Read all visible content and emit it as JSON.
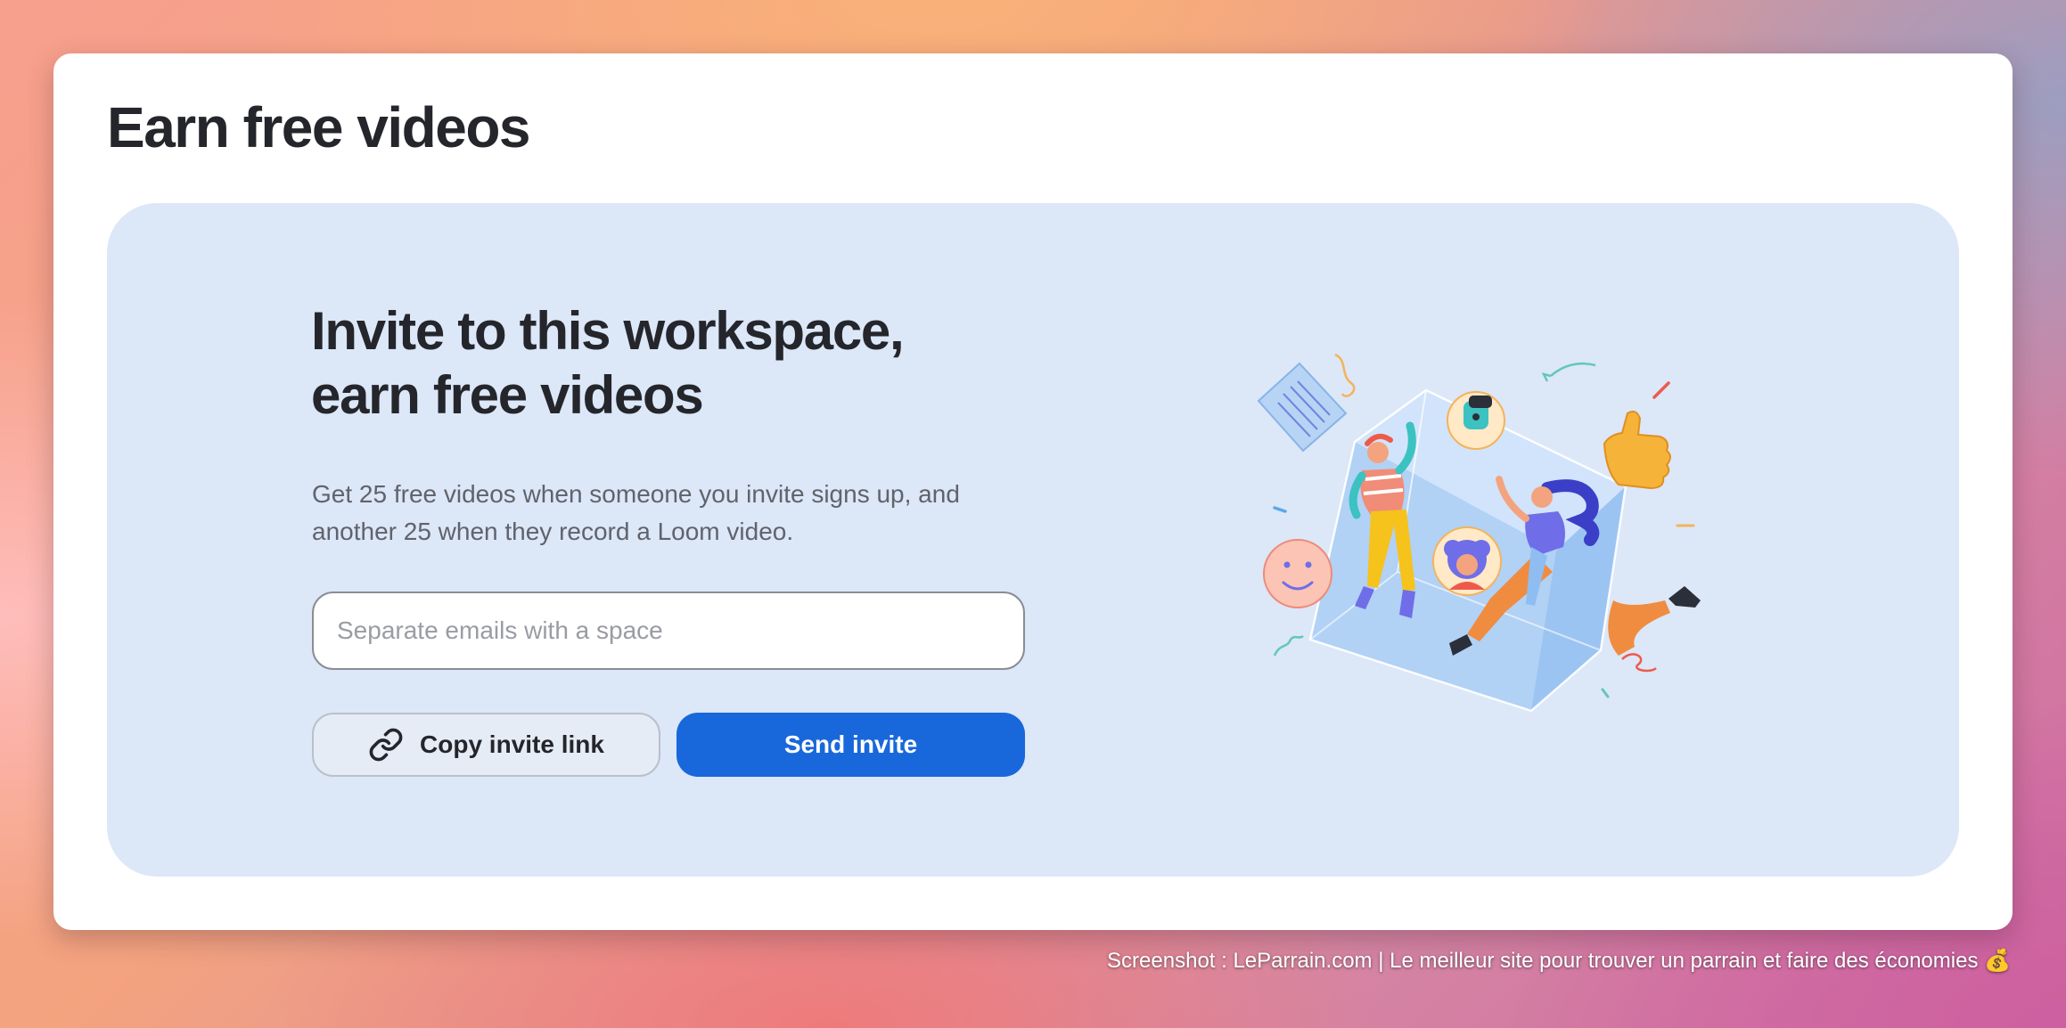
{
  "page": {
    "title": "Earn free videos"
  },
  "invite": {
    "heading_line1": "Invite to this workspace,",
    "heading_line2": "earn free videos",
    "description": "Get 25 free videos when someone you invite signs up, and another 25 when they record a Loom video.",
    "email_placeholder": "Separate emails with a space",
    "email_value": "",
    "copy_label": "Copy invite link",
    "send_label": "Send invite"
  },
  "icons": {
    "copy": "link-icon"
  },
  "colors": {
    "primary": "#1868db",
    "panel_bg": "#dce7f8",
    "text": "#24262b",
    "muted": "#60636b"
  },
  "watermark": {
    "text": "Screenshot : LeParrain.com | Le meilleur site pour trouver un parrain et faire des économies 💰"
  }
}
